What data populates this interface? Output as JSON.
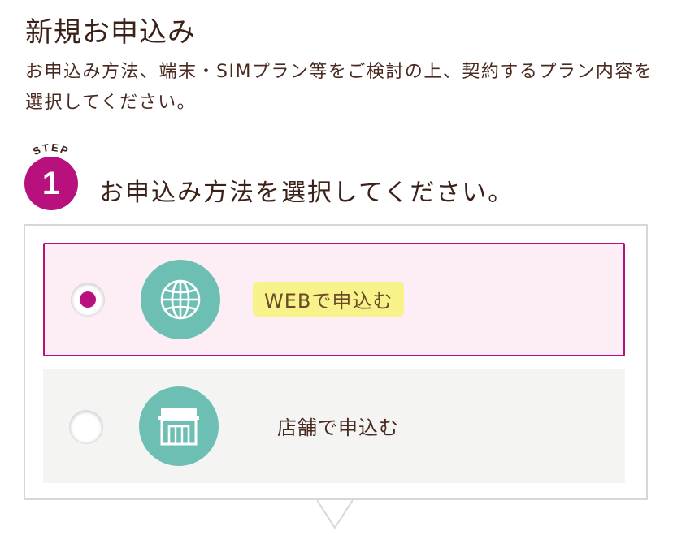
{
  "page": {
    "title": "新規お申込み",
    "description": "お申込み方法、端末・SIMプラン等をご検討の上、契約するプラン内容を選択してください。"
  },
  "step": {
    "label": "STEP",
    "number": "1",
    "title": "お申込み方法を選択してください。"
  },
  "options": [
    {
      "label": "WEBで申込む",
      "selected": true,
      "icon": "globe-icon"
    },
    {
      "label": "店舗で申込む",
      "selected": false,
      "icon": "store-icon"
    }
  ],
  "colors": {
    "accent": "#b8117e",
    "icon_bg": "#6dbfb4",
    "selected_bg": "#fdeef6",
    "unselected_bg": "#f4f4f3",
    "highlight": "#f8f28a",
    "text": "#4a2a20"
  }
}
